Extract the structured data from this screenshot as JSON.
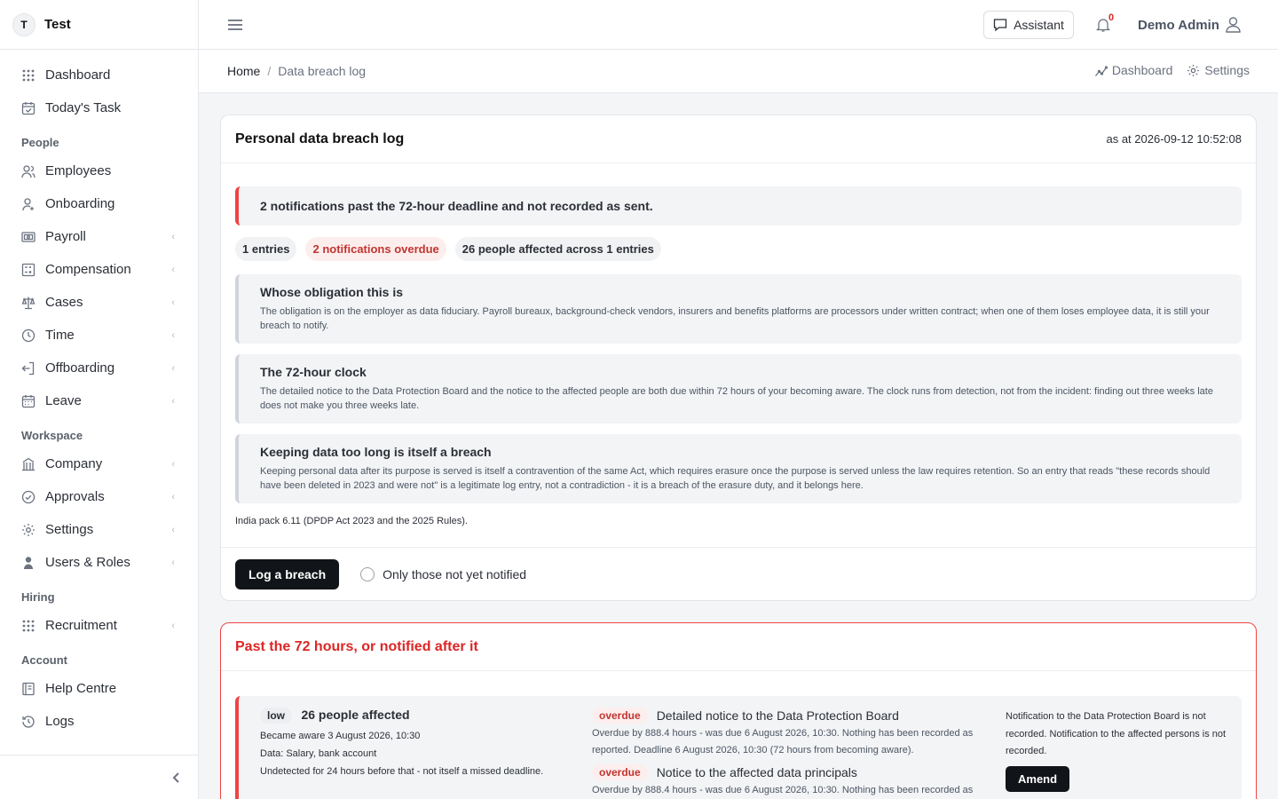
{
  "app": {
    "logo_letter": "T",
    "name": "Test"
  },
  "sidebar": {
    "items_top": [
      {
        "label": "Dashboard",
        "icon": "grid-icon"
      },
      {
        "label": "Today's Task",
        "icon": "calendar-check-icon"
      }
    ],
    "sections": [
      {
        "title": "People",
        "items": [
          {
            "label": "Employees",
            "icon": "users-icon",
            "chevron": false
          },
          {
            "label": "Onboarding",
            "icon": "user-plus-icon",
            "chevron": false
          },
          {
            "label": "Payroll",
            "icon": "payroll-icon",
            "chevron": true
          },
          {
            "label": "Compensation",
            "icon": "calculator-icon",
            "chevron": true
          },
          {
            "label": "Cases",
            "icon": "scale-icon",
            "chevron": true
          },
          {
            "label": "Time",
            "icon": "clock-icon",
            "chevron": true
          },
          {
            "label": "Offboarding",
            "icon": "exit-icon",
            "chevron": true
          },
          {
            "label": "Leave",
            "icon": "calendar-icon",
            "chevron": true
          }
        ]
      },
      {
        "title": "Workspace",
        "items": [
          {
            "label": "Company",
            "icon": "building-icon",
            "chevron": true
          },
          {
            "label": "Approvals",
            "icon": "check-circle-icon",
            "chevron": true
          },
          {
            "label": "Settings",
            "icon": "gear-icon",
            "chevron": true
          },
          {
            "label": "Users & Roles",
            "icon": "user-shield-icon",
            "chevron": true
          }
        ]
      },
      {
        "title": "Hiring",
        "items": [
          {
            "label": "Recruitment",
            "icon": "grid-icon",
            "chevron": true
          }
        ]
      },
      {
        "title": "Account",
        "items": [
          {
            "label": "Help Centre",
            "icon": "book-icon",
            "chevron": false
          },
          {
            "label": "Logs",
            "icon": "history-icon",
            "chevron": false
          }
        ]
      }
    ]
  },
  "topbar": {
    "assistant_label": "Assistant",
    "notification_count": "0",
    "user_name": "Demo Admin"
  },
  "breadcrumb": {
    "home": "Home",
    "separator": "/",
    "current": "Data breach log",
    "actions": {
      "dashboard": "Dashboard",
      "settings": "Settings"
    }
  },
  "log_card": {
    "title": "Personal data breach log",
    "as_at": "as at 2026-09-12 10:52:08",
    "alert": "2 notifications past the 72-hour deadline and not recorded as sent.",
    "chips": {
      "entries": "1 entries",
      "overdue": "2 notifications overdue",
      "affected": "26 people affected across 1 entries"
    },
    "info_blocks": [
      {
        "title": "Whose obligation this is",
        "text": "The obligation is on the employer as data fiduciary. Payroll bureaux, background-check vendors, insurers and benefits platforms are processors under written contract; when one of them loses employee data, it is still your breach to notify."
      },
      {
        "title": "The 72-hour clock",
        "text": "The detailed notice to the Data Protection Board and the notice to the affected people are both due within 72 hours of your becoming aware. The clock runs from detection, not from the incident: finding out three weeks late does not make you three weeks late."
      },
      {
        "title": "Keeping data too long is itself a breach",
        "text": "Keeping personal data after its purpose is served is itself a contravention of the same Act, which requires erasure once the purpose is served unless the law requires retention. So an entry that reads \"these records should have been deleted in 2023 and were not\" is a legitimate log entry, not a contradiction - it is a breach of the erasure duty, and it belongs here."
      }
    ],
    "pack_note": "India pack 6.11 (DPDP Act 2023 and the 2025 Rules).",
    "log_button": "Log a breach",
    "filter_label": "Only those not yet notified"
  },
  "overdue_card": {
    "title": "Past the 72 hours, or notified after it",
    "entry": {
      "severity": "low",
      "affected": "26 people affected",
      "became_aware": "Became aware 3 August 2026, 10:30",
      "data": "Data: Salary, bank account",
      "undetected": "Undetected for 24 hours before that - not itself a missed deadline.",
      "notices": [
        {
          "status": "overdue",
          "title": "Detailed notice to the Data Protection Board",
          "detail": "Overdue by 888.4 hours - was due 6 August 2026, 10:30. Nothing has been recorded as reported. Deadline 6 August 2026, 10:30 (72 hours from becoming aware)."
        },
        {
          "status": "overdue",
          "title": "Notice to the affected data principals",
          "detail": "Overdue by 888.4 hours - was due 6 August 2026, 10:30. Nothing has been recorded as"
        }
      ],
      "summary": "Notification to the Data Protection Board is not recorded. Notification to the affected persons is not recorded.",
      "amend_button": "Amend"
    }
  }
}
